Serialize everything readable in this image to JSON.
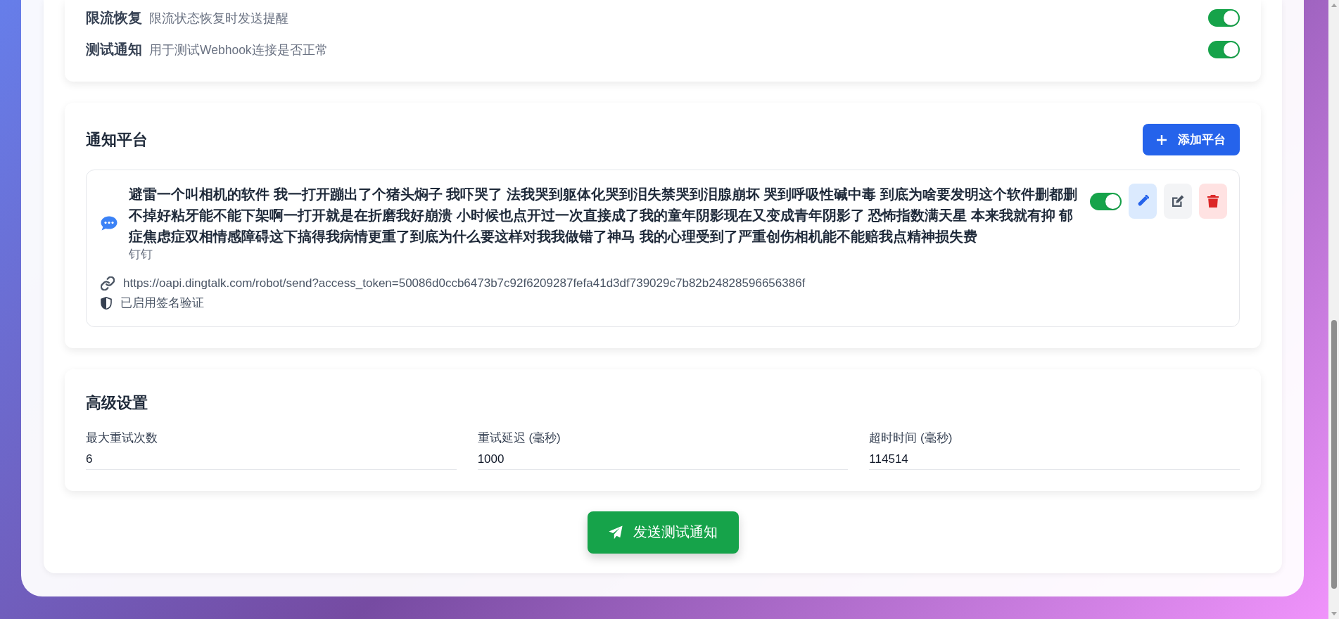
{
  "notification_events": {
    "items": [
      {
        "label": "限流恢复",
        "description": "限流状态恢复时发送提醒",
        "on": true
      },
      {
        "label": "测试通知",
        "description": "用于测试Webhook连接是否正常",
        "on": true
      }
    ]
  },
  "platforms": {
    "title": "通知平台",
    "add_button": "添加平台",
    "items": [
      {
        "name": "避雷一个叫相机的软件 我一打开蹦出了个猪头焖子 我吓哭了 法我哭到躯体化哭到泪失禁哭到泪腺崩坏 哭到呼吸性碱中毒 到底为啥要发明这个软件删都删不掉好粘牙能不能下架啊一打开就是在折磨我好崩溃 小时候也点开过一次直接成了我的童年阴影现在又变成青年阴影了 恐怖指数满天星 本来我就有抑 郁症焦虑症双相情感障碍这下搞得我病情更重了到底为什么要这样对我我做错了神马 我的心理受到了严重创伤相机能不能赔我点精神损失费",
        "platform_label": "钉钉",
        "webhook_url": "https://oapi.dingtalk.com/robot/send?access_token=50086d0ccb6473b7c92f6209287fefa41d3df739029c7b82b24828596656386f",
        "signature": "已启用签名验证",
        "enabled": true
      }
    ]
  },
  "advanced_settings": {
    "title": "高级设置",
    "fields": [
      {
        "label": "最大重试次数",
        "value": "6"
      },
      {
        "label": "重试延迟 (毫秒)",
        "value": "1000"
      },
      {
        "label": "超时时间 (毫秒)",
        "value": "114514"
      }
    ]
  },
  "send_test_button": "发送测试通知"
}
